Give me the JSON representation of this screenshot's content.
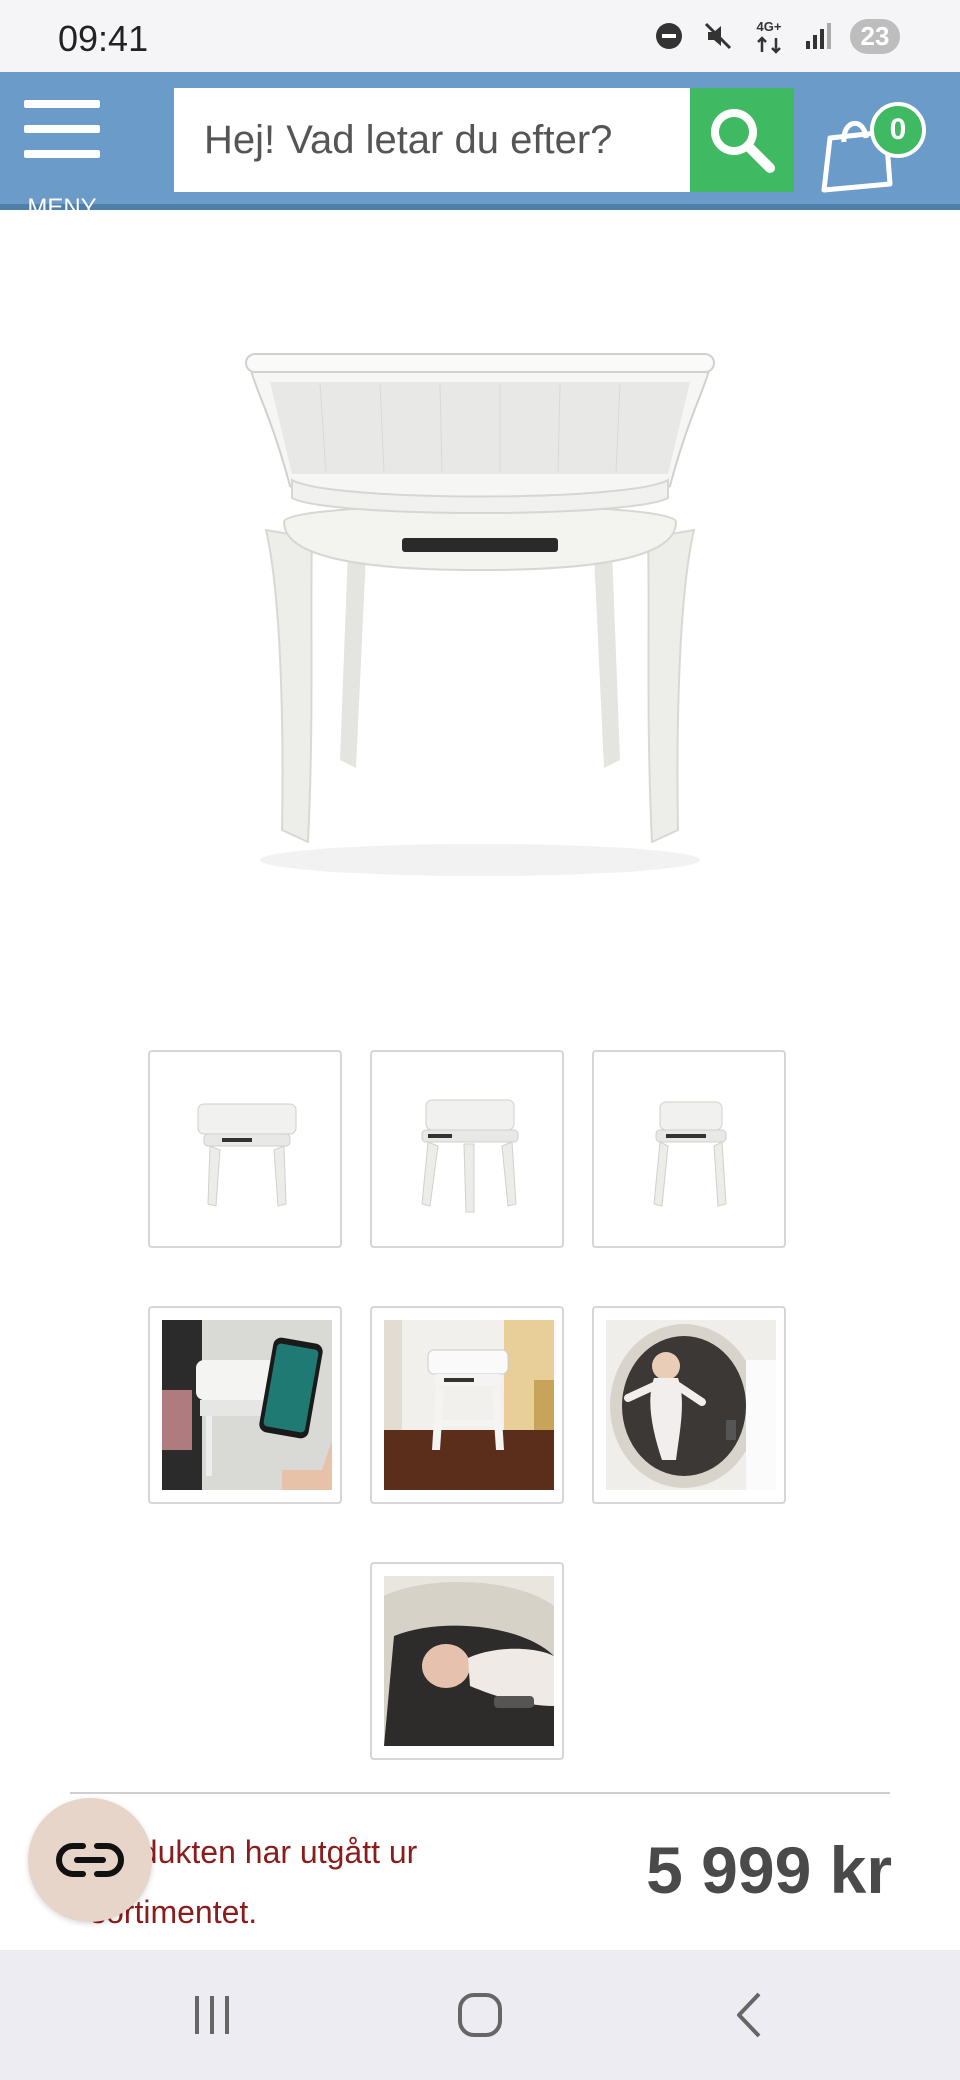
{
  "status_bar": {
    "time": "09:41",
    "network_label": "4G+",
    "notification_count": "23",
    "icons": [
      "do-not-disturb-icon",
      "mute-icon",
      "network-4g-icon",
      "signal-icon"
    ]
  },
  "header": {
    "menu_label": "MENY",
    "search_placeholder": "Hej! Vad letar du efter?",
    "cart_count": "0",
    "colors": {
      "bar": "#6b9cc9",
      "search_button": "#3fba62",
      "cart_badge": "#3fba62"
    }
  },
  "product": {
    "notice": "Produkten har utgått ur sortimentet.",
    "price": "5 999 kr",
    "thumbnails": [
      {
        "name": "thumbnail-bassinet-front"
      },
      {
        "name": "thumbnail-bassinet-angle"
      },
      {
        "name": "thumbnail-bassinet-side"
      },
      {
        "name": "thumbnail-app-phone"
      },
      {
        "name": "thumbnail-bassinet-room"
      },
      {
        "name": "thumbnail-baby-topview"
      },
      {
        "name": "thumbnail-baby-sleeping"
      }
    ]
  },
  "nav": {
    "icons": [
      "recent-apps-icon",
      "home-icon",
      "back-icon"
    ]
  }
}
